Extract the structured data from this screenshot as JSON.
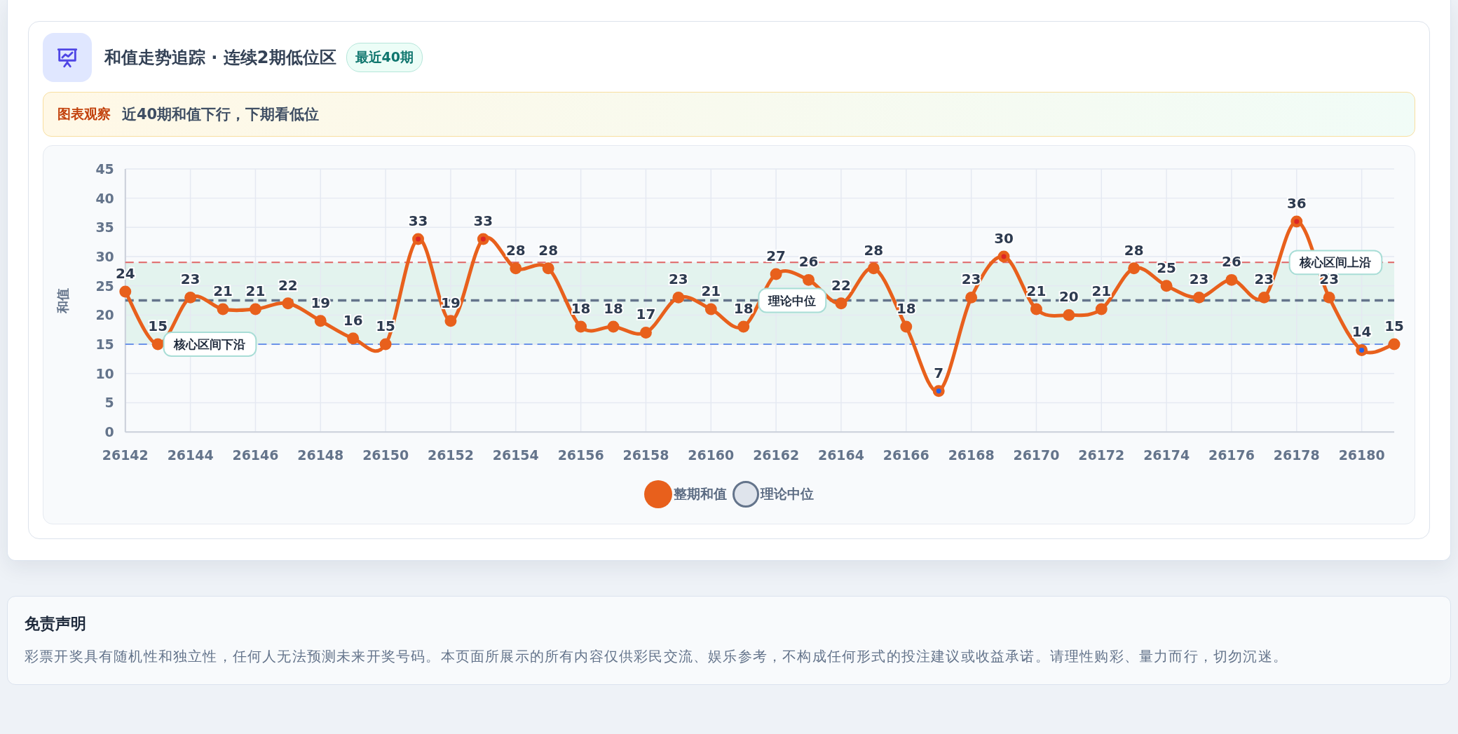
{
  "panel": {
    "title": "和值走势追踪 · 连续2期低位区",
    "badge": "最近40期",
    "observation": {
      "label": "图表观察",
      "text": "近40期和值下行，下期看低位"
    },
    "chart_data": {
      "type": "line",
      "ylabel": "和值",
      "x": [
        26142,
        26143,
        26144,
        26145,
        26146,
        26147,
        26148,
        26149,
        26150,
        26151,
        26152,
        26153,
        26154,
        26155,
        26156,
        26157,
        26158,
        26159,
        26160,
        26161,
        26162,
        26163,
        26164,
        26165,
        26166,
        26167,
        26168,
        26169,
        26170,
        26171,
        26172,
        26173,
        26174,
        26175,
        26176,
        26177,
        26178,
        26179,
        26180,
        26181
      ],
      "series": [
        {
          "name": "整期和值",
          "color": "#e8601c",
          "marker": "circle",
          "values": [
            24,
            15,
            23,
            21,
            21,
            22,
            19,
            16,
            15,
            33,
            19,
            33,
            28,
            28,
            18,
            18,
            17,
            23,
            21,
            18,
            27,
            26,
            22,
            28,
            18,
            7,
            23,
            30,
            21,
            20,
            21,
            28,
            25,
            23,
            26,
            23,
            36,
            23,
            14,
            15
          ]
        }
      ],
      "xlim": [
        26142,
        26181
      ],
      "ylim": [
        0,
        45
      ],
      "xticks": [
        26142,
        26144,
        26146,
        26148,
        26150,
        26152,
        26154,
        26156,
        26158,
        26160,
        26162,
        26164,
        26166,
        26168,
        26170,
        26172,
        26174,
        26176,
        26178,
        26180
      ],
      "yticks": [
        0,
        5,
        10,
        15,
        20,
        25,
        30,
        35,
        40,
        45
      ],
      "grid": true,
      "data_labels": true,
      "bands": [
        {
          "axis": "y",
          "from": 15,
          "to": 29,
          "color": "#e3f3ee"
        }
      ],
      "ref_lines": [
        {
          "axis": "y",
          "value": 29,
          "color": "#e06666",
          "line_style": "dashed"
        },
        {
          "axis": "y",
          "value": 15,
          "color": "#6b93e8",
          "line_style": "dashed"
        },
        {
          "axis": "y",
          "value": 22.5,
          "color": "#64748b",
          "line_style": "dashed"
        }
      ],
      "annotations": [
        {
          "text": "核心区间下沿",
          "x": 26144.6,
          "y": 15
        },
        {
          "text": "理论中位",
          "x": 26162.5,
          "y": 22.5
        },
        {
          "text": "核心区间上沿",
          "x": 26179.2,
          "y": 29
        }
      ]
    },
    "legend": [
      {
        "label": "理论中位",
        "color": "#64748b"
      }
    ]
  },
  "disclaimer": {
    "title": "免责声明",
    "text": "彩票开奖具有随机性和独立性，任何人无法预测未来开奖号码。本页面所展示的所有内容仅供彩民交流、娱乐参考，不构成任何形式的投注建议或收益承诺。请理性购彩、量力而行，切勿沉迷。"
  }
}
